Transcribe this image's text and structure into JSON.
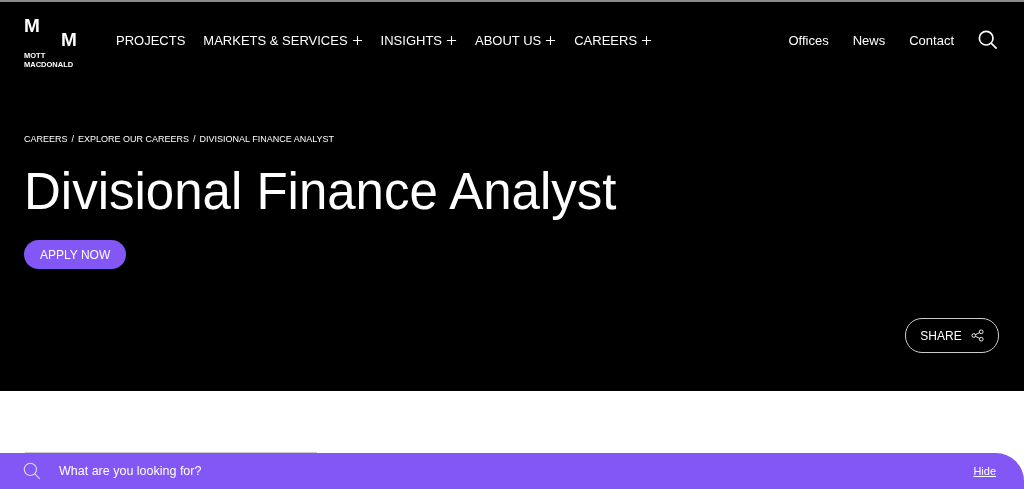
{
  "logo": {
    "letters": [
      "M",
      "M"
    ],
    "name_lines": [
      "MOTT",
      "MACDONALD"
    ]
  },
  "nav": [
    {
      "label": "PROJECTS",
      "has_submenu": false
    },
    {
      "label": "MARKETS & SERVICES",
      "has_submenu": true
    },
    {
      "label": "INSIGHTS",
      "has_submenu": true
    },
    {
      "label": "ABOUT US",
      "has_submenu": true
    },
    {
      "label": "CAREERS",
      "has_submenu": true
    }
  ],
  "utility_links": [
    "Offices",
    "News",
    "Contact"
  ],
  "breadcrumb": {
    "separator": "/",
    "items": [
      "CAREERS",
      "EXPLORE OUR CAREERS",
      "DIVISIONAL FINANCE ANALYST"
    ]
  },
  "title": "Divisional Finance Analyst",
  "apply_button": "APPLY NOW",
  "share_button": "SHARE",
  "search_bar": {
    "placeholder": "What are you looking for?",
    "hide_link": "Hide"
  }
}
